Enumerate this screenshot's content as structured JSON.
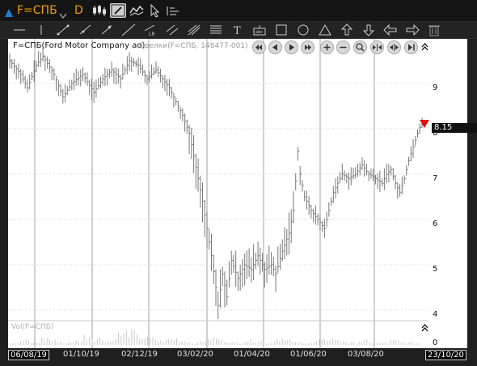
{
  "header": {
    "ticker": "F=СПБ",
    "period": "D",
    "colors": {
      "accent": "#f0a000",
      "arrow": "#1e7fd6"
    }
  },
  "chart_data": {
    "type": "candlestick",
    "title": "F=СПБ(Ford Motor Company ao)",
    "subtitle": "Сделки(F=СПБ, 148477-001)",
    "y_ticks": [
      "9",
      "8",
      "7",
      "6",
      "5",
      "4"
    ],
    "x_ticks": [
      "06/08/19",
      "01/10/19",
      "02/12/19",
      "03/02/20",
      "01/04/20",
      "01/06/20",
      "03/08/20",
      "23/10/20"
    ],
    "ylim": [
      3.8,
      9.9
    ],
    "last_price": "8.15",
    "last_price_value": 8.15,
    "volume_panel": {
      "label": "Vol(F=СПБ)",
      "zero_label": "0"
    },
    "grid": "vertical",
    "price_path": [
      [
        0,
        9.5
      ],
      [
        5,
        9.2
      ],
      [
        8,
        8.9
      ],
      [
        12,
        9.4
      ],
      [
        15,
        9.6
      ],
      [
        20,
        9.2
      ],
      [
        24,
        8.7
      ],
      [
        28,
        9.0
      ],
      [
        33,
        9.2
      ],
      [
        38,
        8.8
      ],
      [
        42,
        9.1
      ],
      [
        46,
        9.3
      ],
      [
        50,
        9.1
      ],
      [
        54,
        9.5
      ],
      [
        58,
        9.4
      ],
      [
        62,
        9.1
      ],
      [
        66,
        9.3
      ],
      [
        69,
        9.1
      ],
      [
        72,
        8.9
      ],
      [
        75,
        8.6
      ],
      [
        78,
        8.3
      ],
      [
        81,
        7.9
      ],
      [
        83,
        7.4
      ],
      [
        85,
        6.9
      ],
      [
        87,
        6.4
      ],
      [
        89,
        5.8
      ],
      [
        91,
        5.2
      ],
      [
        93,
        4.5
      ],
      [
        94,
        4.1
      ],
      [
        96,
        4.8
      ],
      [
        98,
        4.3
      ],
      [
        100,
        5.1
      ],
      [
        103,
        4.7
      ],
      [
        106,
        5.0
      ],
      [
        109,
        4.9
      ],
      [
        112,
        5.2
      ],
      [
        115,
        4.9
      ],
      [
        118,
        5.0
      ],
      [
        120,
        4.8
      ],
      [
        123,
        5.3
      ],
      [
        126,
        5.7
      ],
      [
        128,
        6.2
      ],
      [
        130,
        7.5
      ],
      [
        131,
        7.0
      ],
      [
        133,
        6.5
      ],
      [
        136,
        6.2
      ],
      [
        139,
        6.0
      ],
      [
        142,
        5.8
      ],
      [
        144,
        6.2
      ],
      [
        146,
        6.6
      ],
      [
        148,
        6.8
      ],
      [
        150,
        7.0
      ],
      [
        153,
        6.9
      ],
      [
        156,
        7.0
      ],
      [
        159,
        7.2
      ],
      [
        162,
        7.0
      ],
      [
        165,
        6.9
      ],
      [
        168,
        6.8
      ],
      [
        170,
        7.0
      ],
      [
        172,
        7.1
      ],
      [
        174,
        6.8
      ],
      [
        176,
        6.6
      ],
      [
        178,
        6.9
      ],
      [
        180,
        7.3
      ],
      [
        182,
        7.6
      ],
      [
        184,
        7.9
      ],
      [
        186,
        8.15
      ]
    ],
    "volume_series": [
      1,
      2,
      1,
      3,
      2,
      1,
      2,
      4,
      3,
      2,
      5,
      6,
      4,
      3,
      2,
      3,
      2,
      1,
      2,
      3,
      2,
      1,
      2,
      2,
      1,
      3,
      2,
      1,
      1,
      2,
      3,
      2,
      1,
      2,
      1,
      1,
      2,
      1,
      1
    ]
  }
}
